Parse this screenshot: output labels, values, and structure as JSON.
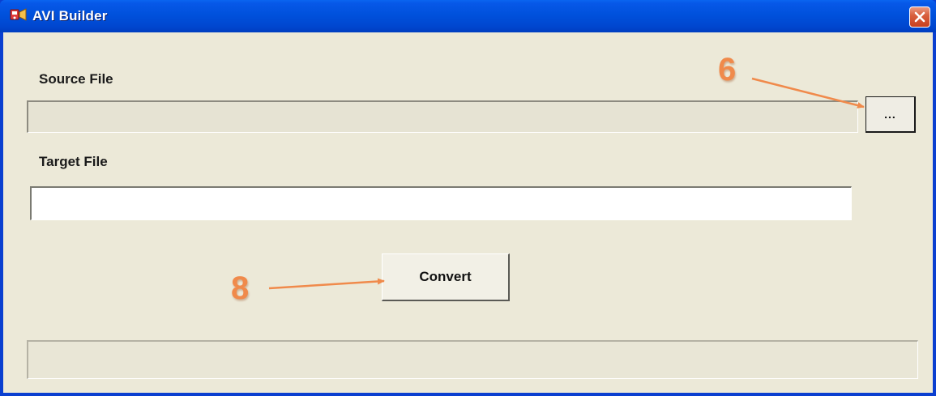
{
  "window": {
    "title": "AVI Builder",
    "icon": "app-icon",
    "close_icon": "close-icon"
  },
  "source": {
    "label": "Source File",
    "value": "",
    "enabled": false,
    "browse_label": "..."
  },
  "target": {
    "label": "Target File",
    "value": "",
    "enabled": true
  },
  "convert": {
    "label": "Convert"
  },
  "status": {
    "text": ""
  },
  "annotations": {
    "browse_step": "6",
    "convert_step": "8",
    "color": "#f08a4b"
  },
  "colors": {
    "title_bar": "#0051dc",
    "client_bg": "#ece9d8",
    "close_button": "#d9603f"
  }
}
